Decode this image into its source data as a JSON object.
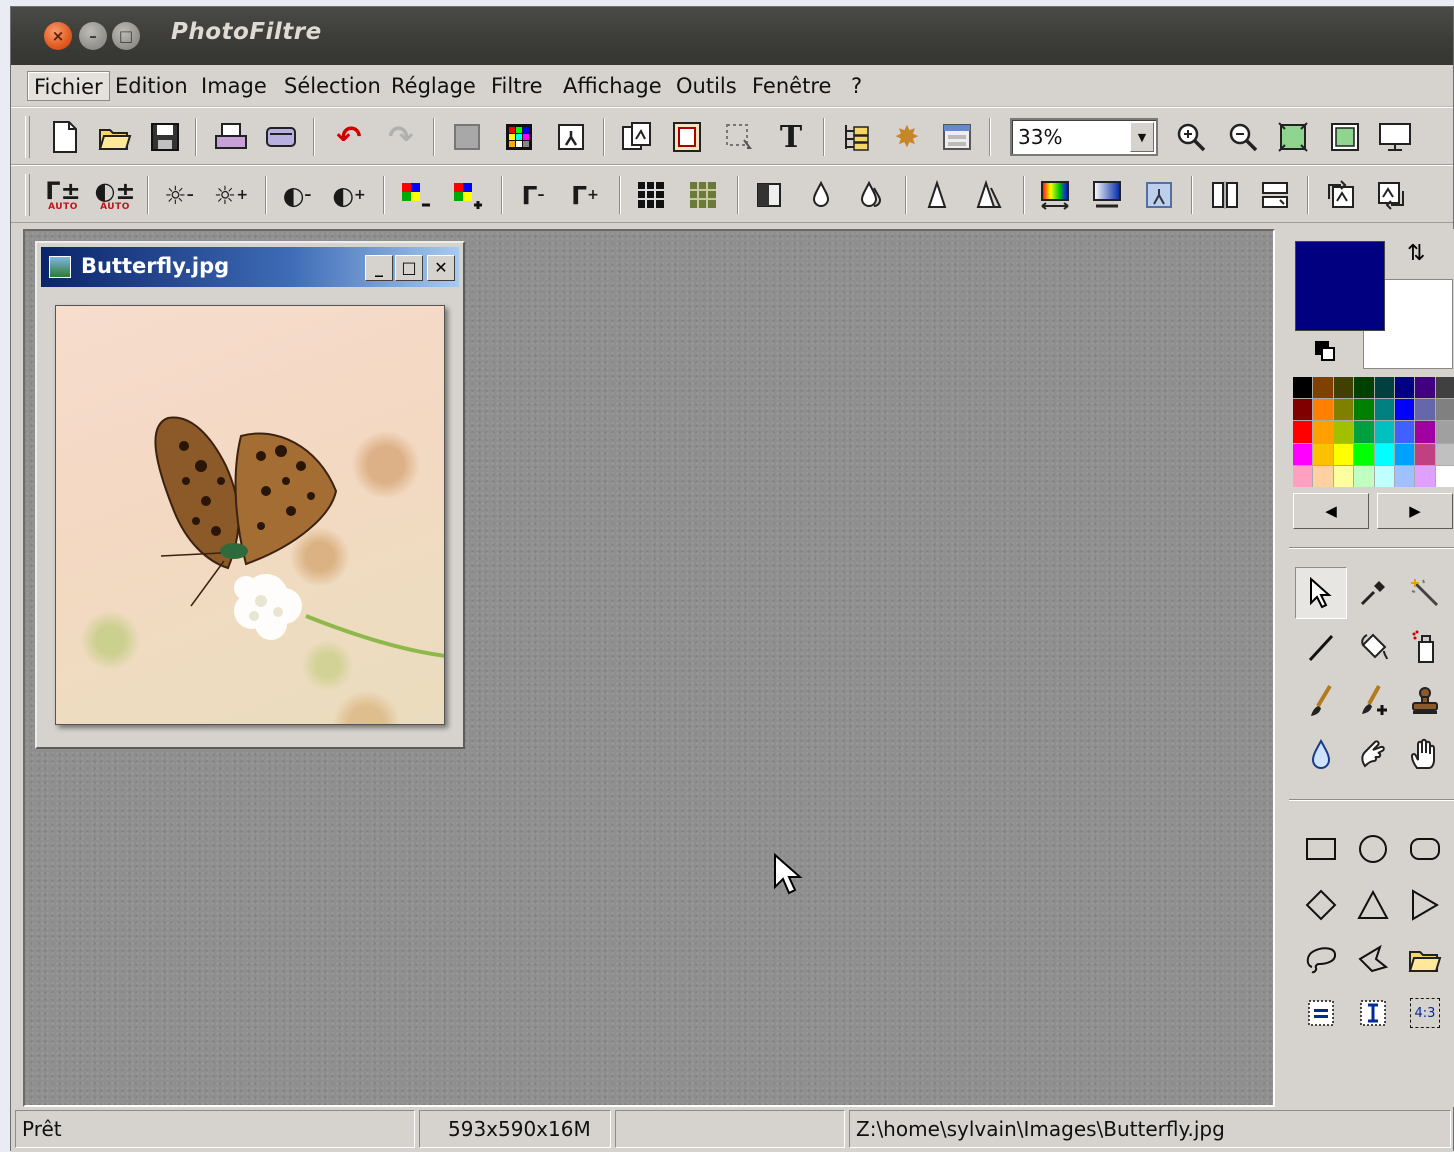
{
  "window": {
    "title": "PhotoFiltre"
  },
  "menu": [
    "Fichier",
    "Edition",
    "Image",
    "Sélection",
    "Réglage",
    "Filtre",
    "Affichage",
    "Outils",
    "Fenêtre",
    "?"
  ],
  "toolbar": {
    "zoom_value": "33%",
    "auto_label": "AUTO"
  },
  "document": {
    "title": "Butterfly.jpg"
  },
  "palette_colors": [
    "#000000",
    "#804000",
    "#404000",
    "#004000",
    "#004040",
    "#000080",
    "#400080",
    "#404040",
    "#800000",
    "#ff8000",
    "#808000",
    "#008000",
    "#008080",
    "#0000ff",
    "#6666aa",
    "#808080",
    "#ff0000",
    "#ffa000",
    "#a0c000",
    "#00a040",
    "#00c0c0",
    "#4060ff",
    "#a000a0",
    "#a0a0a0",
    "#ff00ff",
    "#ffc000",
    "#ffff00",
    "#00ff00",
    "#00ffff",
    "#00a0ff",
    "#c04080",
    "#c0c0c0",
    "#ffa0c0",
    "#ffd0a0",
    "#ffffa0",
    "#c0ffc0",
    "#c0ffff",
    "#a0c0ff",
    "#e0a0ff",
    "#ffffff"
  ],
  "colors": {
    "foreground": "#000080",
    "background": "#ffffff"
  },
  "tools": {
    "ratio_label": "4:3"
  },
  "status": {
    "state": "Prêt",
    "image_info": "593x590x16M",
    "empty": "",
    "file_path": "Z:\\home\\sylvain\\Images\\Butterfly.jpg"
  }
}
